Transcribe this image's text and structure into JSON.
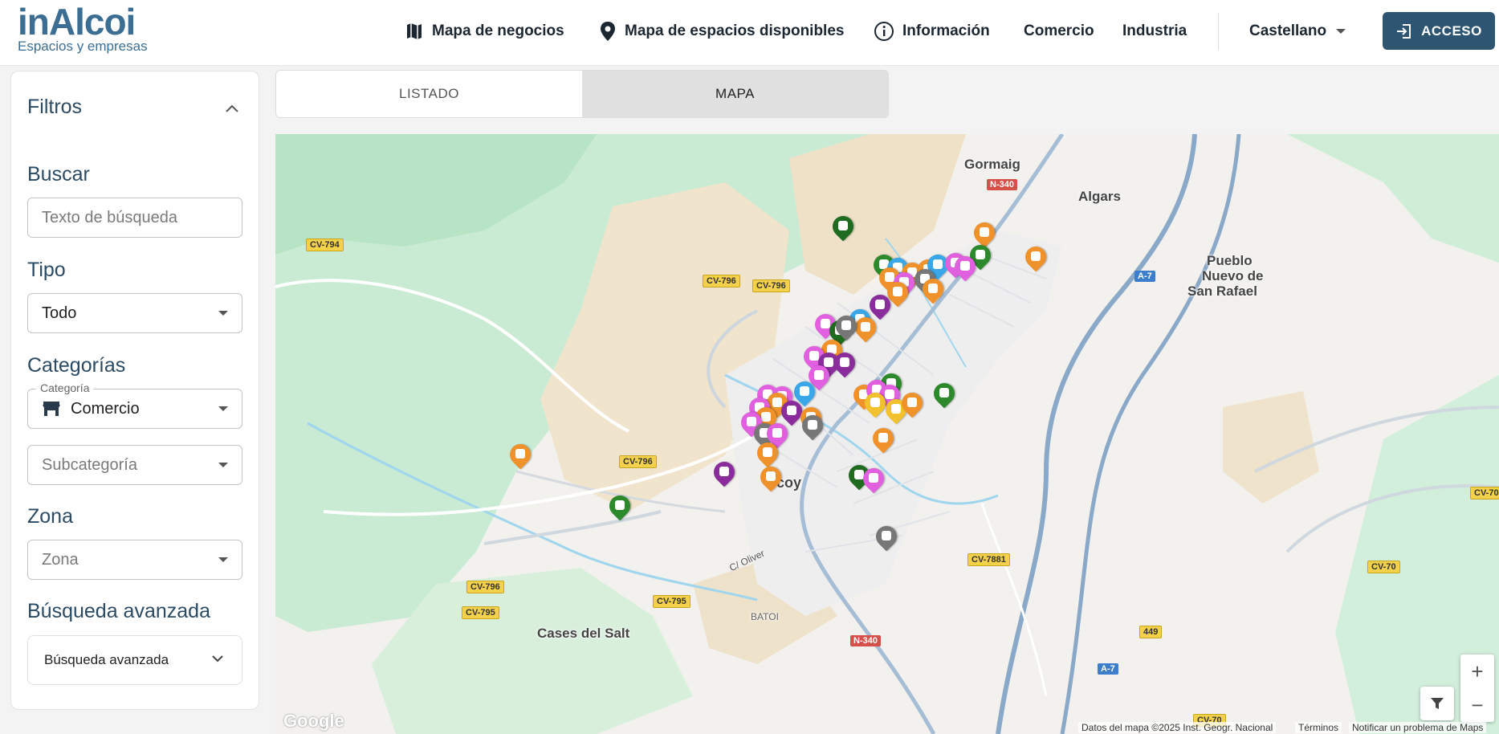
{
  "header": {
    "logo_main": "inAlcoi",
    "logo_sub": "Espacios y empresas",
    "nav": [
      {
        "label": "Mapa de negocios",
        "icon": "map-icon"
      },
      {
        "label": "Mapa de espacios disponibles",
        "icon": "location-pin-icon"
      },
      {
        "label": "Información",
        "icon": "info-icon"
      },
      {
        "label": "Comercio"
      },
      {
        "label": "Industria"
      }
    ],
    "language": "Castellano",
    "login_label": "ACCESO"
  },
  "sidebar": {
    "title": "Filtros",
    "search_label": "Buscar",
    "search_placeholder": "Texto de búsqueda",
    "type_label": "Tipo",
    "type_value": "Todo",
    "categories_label": "Categorías",
    "category_float_label": "Categoría",
    "category_value": "Comercio",
    "subcategory_placeholder": "Subcategoría",
    "zone_label": "Zona",
    "zone_placeholder": "Zona",
    "advanced_label": "Búsqueda avanzada",
    "advanced_button": "Búsqueda avanzada"
  },
  "tabs": [
    {
      "label": "LISTADO",
      "active": false
    },
    {
      "label": "MAPA",
      "active": true
    }
  ],
  "map": {
    "places": [
      "Gormaig",
      "Algars",
      "Pueblo",
      "Nuevo de",
      "San Rafael",
      "Cases del Salt",
      "coy",
      "BATOI"
    ],
    "roads": [
      "N-340",
      "A-7",
      "CV-794",
      "CV-796",
      "CV-796",
      "CV-796",
      "CV-796",
      "CV-795",
      "CV-795",
      "CV-7881",
      "N-340",
      "449",
      "A-7",
      "CV-70",
      "CV-70",
      "CV-70"
    ],
    "street": "C/ Oliver",
    "attribution": "Datos del mapa ©2025 Inst. Geogr. Nacional",
    "terms": "Términos",
    "report": "Notificar un problema de Maps",
    "google_logo": "Google",
    "marker_colors": {
      "comercio": "#f0922b",
      "moda": "#e060e0",
      "alimentacion": "#2c8a2c",
      "servicios": "#8a2c9c",
      "salud": "#3aa8e8",
      "otros": "#777777",
      "hosteleria": "#f2c12e"
    }
  }
}
